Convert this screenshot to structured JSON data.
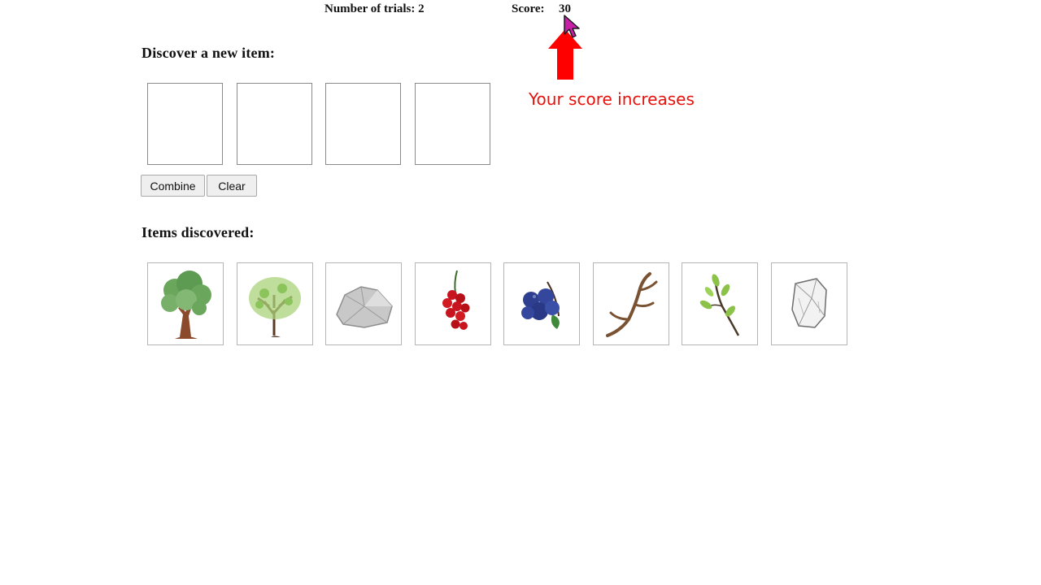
{
  "header": {
    "trials_label": "Number of trials: 2",
    "score_label": "Score:",
    "score_value": "30"
  },
  "discover": {
    "title": "Discover a new item:",
    "slots": [
      "",
      "",
      "",
      ""
    ],
    "combine_label": "Combine",
    "clear_label": "Clear"
  },
  "discovered": {
    "title": "Items discovered:",
    "items": [
      {
        "icon": "tree-icon"
      },
      {
        "icon": "young-tree-icon"
      },
      {
        "icon": "rock-icon"
      },
      {
        "icon": "red-berries-icon"
      },
      {
        "icon": "blueberries-icon"
      },
      {
        "icon": "antler-icon"
      },
      {
        "icon": "twig-icon"
      },
      {
        "icon": "stone-sketch-icon"
      }
    ]
  },
  "annotation": {
    "text": "Your score increases",
    "color": "#e8120c"
  }
}
